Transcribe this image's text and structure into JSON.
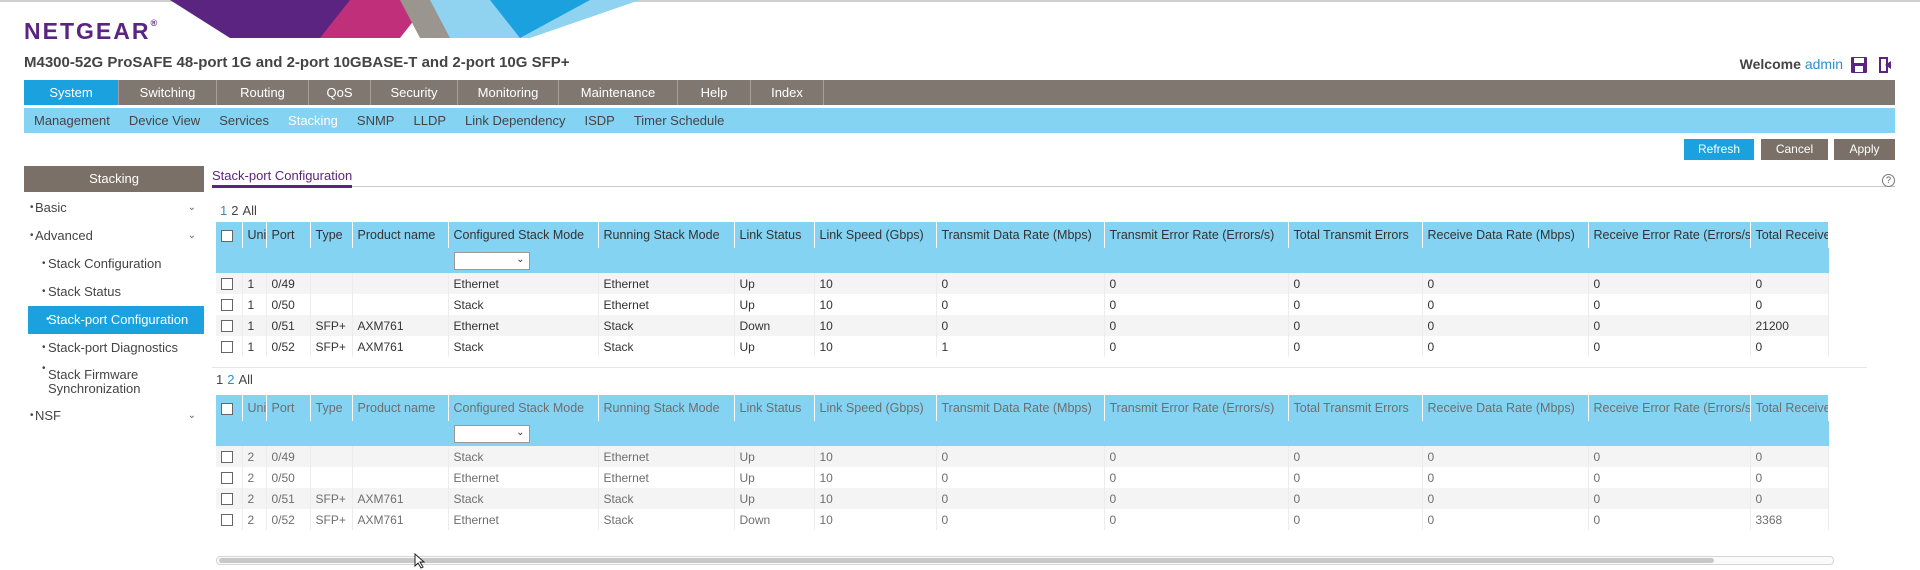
{
  "brand": {
    "name": "NETGEAR",
    "trademark": "®"
  },
  "product_title": "M4300-52G ProSAFE 48-port 1G and 2-port 10GBASE-T and 2-port 10G SFP+",
  "welcome": {
    "label": "Welcome",
    "user": "admin"
  },
  "header_icons": {
    "save": "save-icon",
    "logout": "logout-icon"
  },
  "main_nav": [
    {
      "label": "System",
      "active": true
    },
    {
      "label": "Switching"
    },
    {
      "label": "Routing"
    },
    {
      "label": "QoS"
    },
    {
      "label": "Security"
    },
    {
      "label": "Monitoring"
    },
    {
      "label": "Maintenance"
    },
    {
      "label": "Help"
    },
    {
      "label": "Index"
    }
  ],
  "sub_nav": [
    {
      "label": "Management"
    },
    {
      "label": "Device View"
    },
    {
      "label": "Services"
    },
    {
      "label": "Stacking",
      "active": true
    },
    {
      "label": "SNMP"
    },
    {
      "label": "LLDP"
    },
    {
      "label": "Link Dependency"
    },
    {
      "label": "ISDP"
    },
    {
      "label": "Timer Schedule"
    }
  ],
  "buttons": {
    "refresh": "Refresh",
    "cancel": "Cancel",
    "apply": "Apply"
  },
  "sidebar": {
    "title": "Stacking",
    "items": [
      {
        "label": "Basic",
        "level": 1,
        "chevron": true
      },
      {
        "label": "Advanced",
        "level": 1,
        "chevron": true
      },
      {
        "label": "Stack Configuration",
        "level": 2
      },
      {
        "label": "Stack Status",
        "level": 2
      },
      {
        "label": "Stack-port Configuration",
        "level": 2,
        "active": true
      },
      {
        "label": "Stack-port Diagnostics",
        "level": 2
      },
      {
        "label": "Stack Firmware Synchronization",
        "level": 2
      },
      {
        "label": "NSF",
        "level": 1,
        "chevron": true
      }
    ]
  },
  "section_title": "Stack-port Configuration",
  "pager": {
    "pages": [
      "1",
      "2",
      "All"
    ]
  },
  "columns": [
    "Unit ID",
    "Port",
    "Type",
    "Product name",
    "Configured Stack Mode",
    "Running Stack Mode",
    "Link Status",
    "Link Speed (Gbps)",
    "Transmit Data Rate (Mbps)",
    "Transmit Error Rate (Errors/s)",
    "Total Transmit Errors",
    "Receive Data Rate (Mbps)",
    "Receive Error Rate (Errors/s)",
    "Total Receive"
  ],
  "table1": {
    "rows": [
      [
        "1",
        "0/49",
        "",
        "",
        "Ethernet",
        "Ethernet",
        "Up",
        "10",
        "0",
        "0",
        "0",
        "0",
        "0",
        "0"
      ],
      [
        "1",
        "0/50",
        "",
        "",
        "Stack",
        "Ethernet",
        "Up",
        "10",
        "0",
        "0",
        "0",
        "0",
        "0",
        "0"
      ],
      [
        "1",
        "0/51",
        "SFP+",
        "AXM761",
        "Ethernet",
        "Stack",
        "Down",
        "10",
        "0",
        "0",
        "0",
        "0",
        "0",
        "21200"
      ],
      [
        "1",
        "0/52",
        "SFP+",
        "AXM761",
        "Stack",
        "Stack",
        "Up",
        "10",
        "1",
        "0",
        "0",
        "0",
        "0",
        "0"
      ]
    ]
  },
  "table2": {
    "rows": [
      [
        "2",
        "0/49",
        "",
        "",
        "Stack",
        "Ethernet",
        "Up",
        "10",
        "0",
        "0",
        "0",
        "0",
        "0",
        "0"
      ],
      [
        "2",
        "0/50",
        "",
        "",
        "Ethernet",
        "Ethernet",
        "Up",
        "10",
        "0",
        "0",
        "0",
        "0",
        "0",
        "0"
      ],
      [
        "2",
        "0/51",
        "SFP+",
        "AXM761",
        "Stack",
        "Stack",
        "Up",
        "10",
        "0",
        "0",
        "0",
        "0",
        "0",
        "0"
      ],
      [
        "2",
        "0/52",
        "SFP+",
        "AXM761",
        "Ethernet",
        "Stack",
        "Down",
        "10",
        "0",
        "0",
        "0",
        "0",
        "0",
        "3368"
      ]
    ]
  }
}
